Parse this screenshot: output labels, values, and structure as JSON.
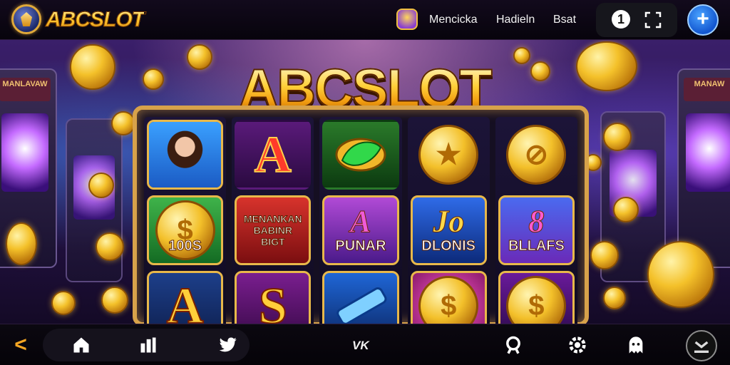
{
  "header": {
    "brand": "ABCSLOT",
    "nav_links": [
      "Mencicka",
      "Hadieln",
      "Bsat"
    ],
    "icons": [
      "mascot-icon",
      "info-icon",
      "fullscreen-icon",
      "plus-icon"
    ],
    "info_label": "1",
    "plus_label": "+"
  },
  "hero": {
    "title": "ABCSLOT",
    "cabinet_signs": [
      "MANLAVAW",
      "MANAW"
    ],
    "reels": [
      [
        {
          "type": "portrait",
          "text": ""
        },
        {
          "type": "coin",
          "text": "100S"
        },
        {
          "type": "letter",
          "text": "A"
        }
      ],
      [
        {
          "type": "letter",
          "text": "A"
        },
        {
          "type": "label",
          "text": "MENANKAN BABINR BIGT"
        },
        {
          "type": "letter",
          "text": "S"
        }
      ],
      [
        {
          "type": "gem",
          "text": ""
        },
        {
          "type": "symbol",
          "symbol": "A",
          "text": "PUNAR"
        },
        {
          "type": "bar",
          "text": ""
        }
      ],
      [
        {
          "type": "coin",
          "text": ""
        },
        {
          "type": "symbol",
          "symbol": "Jo",
          "text": "DLONIS"
        },
        {
          "type": "coin",
          "text": ""
        }
      ],
      [
        {
          "type": "coin",
          "text": ""
        },
        {
          "type": "symbol",
          "symbol": "8",
          "text": "BLLAFS"
        },
        {
          "type": "coin",
          "text": ""
        }
      ]
    ]
  },
  "footer": {
    "icons": [
      "back-icon",
      "home-icon",
      "stats-icon",
      "twitter-icon",
      "search-icon",
      "settings-icon",
      "ghost-icon",
      "profile-icon"
    ],
    "center_text": "VK",
    "back_label": "<"
  },
  "colors": {
    "gold": "#f4c12a",
    "purple": "#3a1f6a",
    "blue": "#1256d0",
    "accent_orange": "#f5a623"
  }
}
